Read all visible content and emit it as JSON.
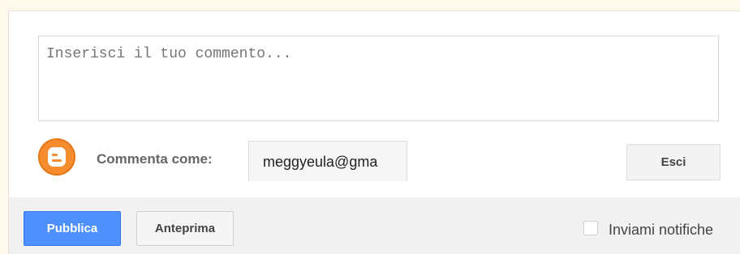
{
  "comment": {
    "placeholder": "Inserisci il tuo commento...",
    "value": ""
  },
  "identity": {
    "label": "Commenta come:",
    "account": "meggyeula@gma",
    "logo_icon": "blogger-logo-icon"
  },
  "buttons": {
    "sign_out": "Esci",
    "publish": "Pubblica",
    "preview": "Anteprima"
  },
  "notifications": {
    "label": "Inviami notifiche",
    "checked": false
  },
  "colors": {
    "page_background": "#fff8ec",
    "publish_blue": "#4d90fe",
    "blogger_orange": "#f58d2e",
    "action_bar": "#f1f1f1"
  }
}
